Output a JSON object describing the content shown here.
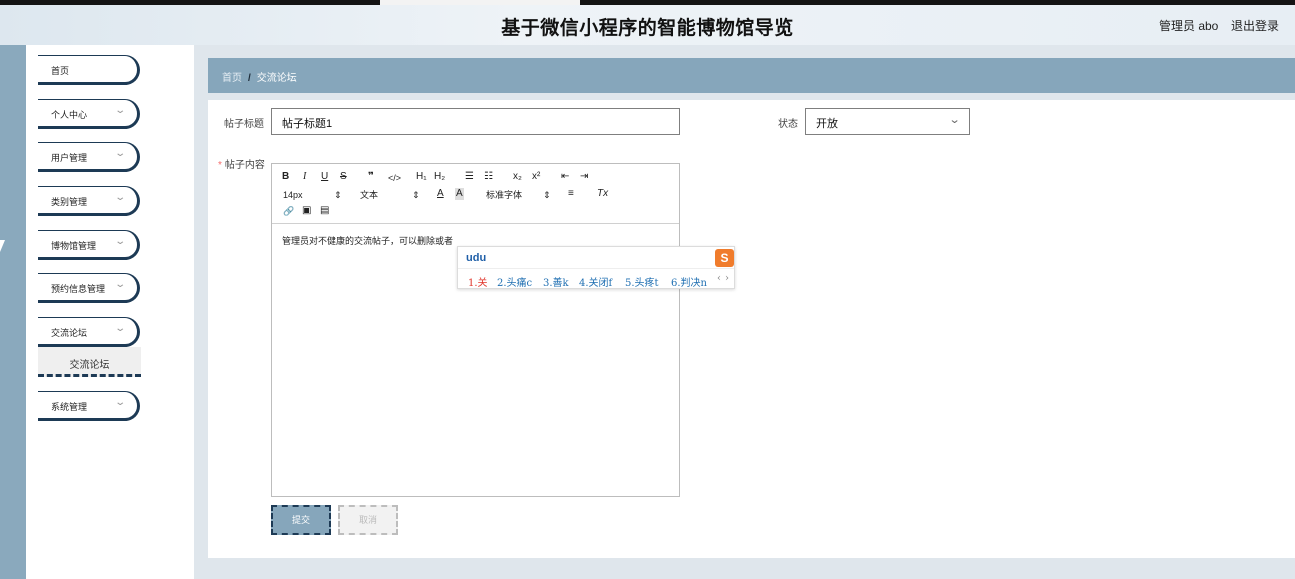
{
  "header": {
    "title": "基于微信小程序的智能博物馆导览",
    "user": "管理员 abo",
    "logout": "退出登录"
  },
  "sidebar": {
    "items": [
      {
        "label": "首页"
      },
      {
        "label": "个人中心"
      },
      {
        "label": "用户管理"
      },
      {
        "label": "类别管理"
      },
      {
        "label": "博物馆管理"
      },
      {
        "label": "预约信息管理"
      },
      {
        "label": "交流论坛"
      },
      {
        "label": "系统管理"
      }
    ],
    "sub_item": "交流论坛"
  },
  "breadcrumb": {
    "home": "首页",
    "sep": "/",
    "current": "交流论坛"
  },
  "form": {
    "title_label": "帖子标题",
    "title_value": "帖子标题1",
    "status_label": "状态",
    "status_value": "开放",
    "content_required": "*",
    "content_label": "帖子内容",
    "content_text": "管理员对不健康的交流帖子，可以删除或者",
    "submit": "提交",
    "cancel": "取消"
  },
  "toolbar": {
    "bold": "B",
    "italic": "I",
    "underline": "U",
    "strike": "S",
    "quote": "❞",
    "code": "</>",
    "h1": "H₁",
    "h2": "H₂",
    "ordered_list": "☰",
    "bullet_list": "☷",
    "subscript": "x₂",
    "superscript": "x²",
    "outdent": "⇤",
    "indent": "⇥",
    "size": "14px",
    "size_caret": "⇕",
    "type": "文本",
    "type_caret": "⇕",
    "color": "A",
    "background": "A",
    "font": "标准字体",
    "font_caret": "⇕",
    "align": "≡",
    "clear": "Tx",
    "link": "🔗",
    "image": "▣",
    "video": "▤"
  },
  "ime": {
    "composition": "udu",
    "candidates": [
      "1.关",
      "2.头痛c",
      "3.善k",
      "4.关闭f",
      "5.头疼t",
      "6.判决n"
    ],
    "prev": "‹",
    "next": "›",
    "logo": "S"
  }
}
